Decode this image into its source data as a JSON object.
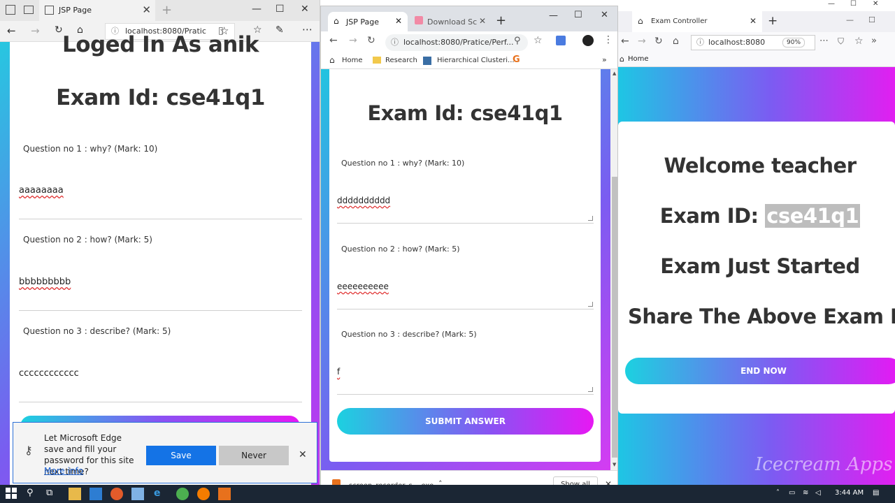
{
  "edge": {
    "tab_title": "JSP Page",
    "url": "localhost:8080/Pratic",
    "heading_logged": "Loged In As anik",
    "heading_exam": "Exam Id: cse41q1",
    "questions": [
      {
        "label": "Question no 1 : why? (Mark: 10)",
        "answer": "aaaaaaaa"
      },
      {
        "label": "Question no 2 : how? (Mark: 5)",
        "answer": "bbbbbbbbb"
      },
      {
        "label": "Question no 3 : describe? (Mark: 5)",
        "answer": "cccccccccccc"
      }
    ],
    "password_prompt": {
      "message": "Let Microsoft Edge save and fill your password for this site next time?",
      "more_info": "More info",
      "save": "Save",
      "never": "Never"
    }
  },
  "chrome": {
    "tabs": [
      {
        "title": "JSP Page"
      },
      {
        "title": "Download Sc"
      }
    ],
    "url": "localhost:8080/Pratice/Perf...",
    "bookmarks": [
      "Home",
      "Research",
      "Hierarchical Clusteri..."
    ],
    "heading_exam": "Exam Id: cse41q1",
    "questions": [
      {
        "label": "Question no 1 : why? (Mark: 10)",
        "answer": "dddddddddd"
      },
      {
        "label": "Question no 2 : how? (Mark: 5)",
        "answer": "eeeeeeeeee"
      },
      {
        "label": "Question no 3 : describe? (Mark: 5)",
        "answer": "f"
      }
    ],
    "submit": "SUBMIT ANSWER",
    "download": {
      "file": "screen_recorder_s....exe",
      "show_all": "Show all"
    }
  },
  "firefox": {
    "tab_title": "Exam Controller",
    "url": "localhost:8080",
    "zoom": "90%",
    "bookmark_home": "Home",
    "welcome": "Welcome teacher",
    "exam_id_label": "Exam ID:",
    "exam_id_value": "cse41q1",
    "status": "Exam Just Started",
    "share": "Share The Above Exam Id",
    "end_button": "END NOW"
  },
  "taskbar": {
    "time": "3:44 AM",
    "watermark": "Icecream Apps"
  },
  "colors": {
    "gradient_start": "#1cd1e0",
    "gradient_mid": "#8a52f3",
    "gradient_end": "#e718f3",
    "edge_blue": "#1473e6",
    "taskbar": "#1b2634"
  }
}
